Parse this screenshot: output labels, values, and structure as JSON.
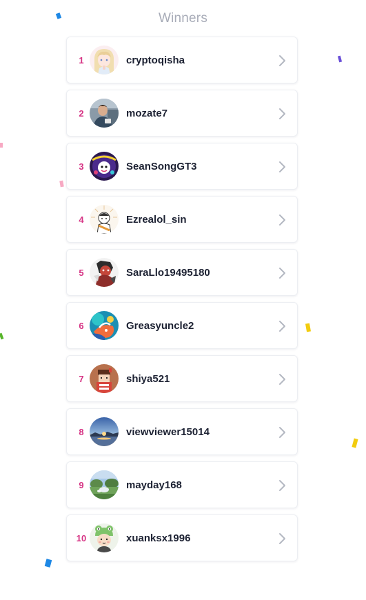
{
  "page": {
    "title": "Winners"
  },
  "colors": {
    "rank": "#d63384",
    "username": "#1d2233",
    "title": "#a8acb8",
    "chevron": "#b4b8c2"
  },
  "winners": [
    {
      "rank": "1",
      "username": "cryptoqisha",
      "avatar_icon": "anime-girl-avatar"
    },
    {
      "rank": "2",
      "username": "mozate7",
      "avatar_icon": "man-photo-avatar"
    },
    {
      "rank": "3",
      "username": "SeanSongGT3",
      "avatar_icon": "purple-emblem-avatar"
    },
    {
      "rank": "4",
      "username": "Ezrealol_sin",
      "avatar_icon": "cartoon-boy-avatar"
    },
    {
      "rank": "5",
      "username": "SaraLlo19495180",
      "avatar_icon": "red-character-avatar"
    },
    {
      "rank": "6",
      "username": "Greasyuncle2",
      "avatar_icon": "colorful-art-avatar"
    },
    {
      "rank": "7",
      "username": "shiya521",
      "avatar_icon": "pixel-character-avatar"
    },
    {
      "rank": "8",
      "username": "viewviewer15014",
      "avatar_icon": "sunset-lake-avatar"
    },
    {
      "rank": "9",
      "username": "mayday168",
      "avatar_icon": "park-photo-avatar"
    },
    {
      "rank": "10",
      "username": "xuanksx1996",
      "avatar_icon": "frog-hat-avatar"
    }
  ]
}
